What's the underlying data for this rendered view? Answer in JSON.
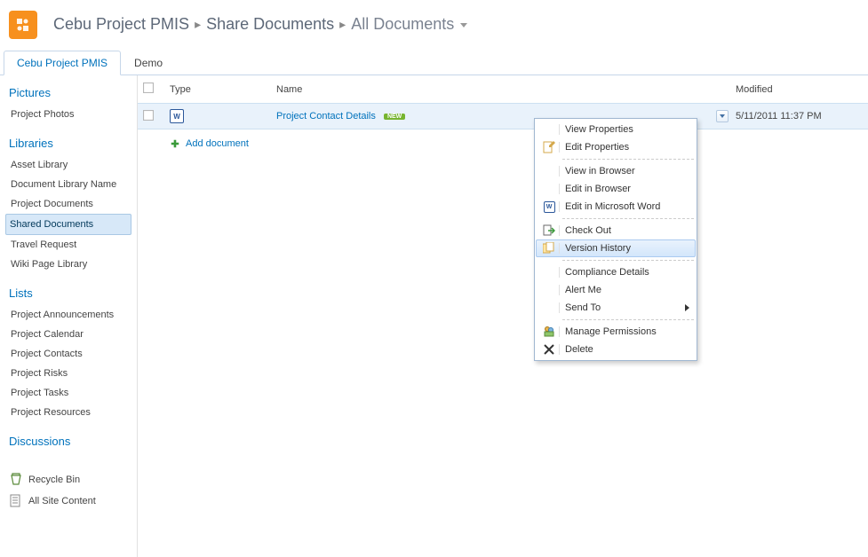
{
  "breadcrumb": {
    "site": "Cebu Project PMIS",
    "library": "Share Documents",
    "view": "All Documents"
  },
  "tabs": [
    {
      "label": "Cebu Project PMIS",
      "active": true
    },
    {
      "label": "Demo",
      "active": false
    }
  ],
  "sidebar": {
    "sections": [
      {
        "title": "Pictures",
        "items": [
          {
            "label": "Project Photos",
            "selected": false
          }
        ]
      },
      {
        "title": "Libraries",
        "items": [
          {
            "label": "Asset Library",
            "selected": false
          },
          {
            "label": "Document Library Name",
            "selected": false
          },
          {
            "label": "Project Documents",
            "selected": false
          },
          {
            "label": "Shared Documents",
            "selected": true
          },
          {
            "label": "Travel Request",
            "selected": false
          },
          {
            "label": "Wiki Page Library",
            "selected": false
          }
        ]
      },
      {
        "title": "Lists",
        "items": [
          {
            "label": "Project Announcements",
            "selected": false
          },
          {
            "label": "Project Calendar",
            "selected": false
          },
          {
            "label": "Project Contacts",
            "selected": false
          },
          {
            "label": "Project Risks",
            "selected": false
          },
          {
            "label": "Project Tasks",
            "selected": false
          },
          {
            "label": "Project Resources",
            "selected": false
          }
        ]
      },
      {
        "title": "Discussions",
        "items": []
      }
    ],
    "footer": {
      "recycle_bin": "Recycle Bin",
      "all_site_content": "All Site Content"
    }
  },
  "table": {
    "columns": {
      "type": "Type",
      "name": "Name",
      "modified": "Modified"
    },
    "rows": [
      {
        "icon": "word",
        "name": "Project Contact Details",
        "new_badge": "NEW",
        "modified": "5/11/2011 11:37 PM",
        "selected": true
      }
    ],
    "add_document": "Add document"
  },
  "context_menu": {
    "groups": [
      [
        {
          "label": "View Properties",
          "icon": null
        },
        {
          "label": "Edit Properties",
          "icon": "edit-properties"
        }
      ],
      [
        {
          "label": "View in Browser",
          "icon": null
        },
        {
          "label": "Edit in Browser",
          "icon": null
        },
        {
          "label": "Edit in Microsoft Word",
          "icon": "word"
        }
      ],
      [
        {
          "label": "Check Out",
          "icon": "checkout"
        },
        {
          "label": "Version History",
          "icon": "version",
          "highlight": true
        }
      ],
      [
        {
          "label": "Compliance Details",
          "icon": null
        },
        {
          "label": "Alert Me",
          "icon": null
        },
        {
          "label": "Send To",
          "icon": null,
          "submenu": true
        }
      ],
      [
        {
          "label": "Manage Permissions",
          "icon": "permissions"
        },
        {
          "label": "Delete",
          "icon": "delete"
        }
      ]
    ]
  }
}
